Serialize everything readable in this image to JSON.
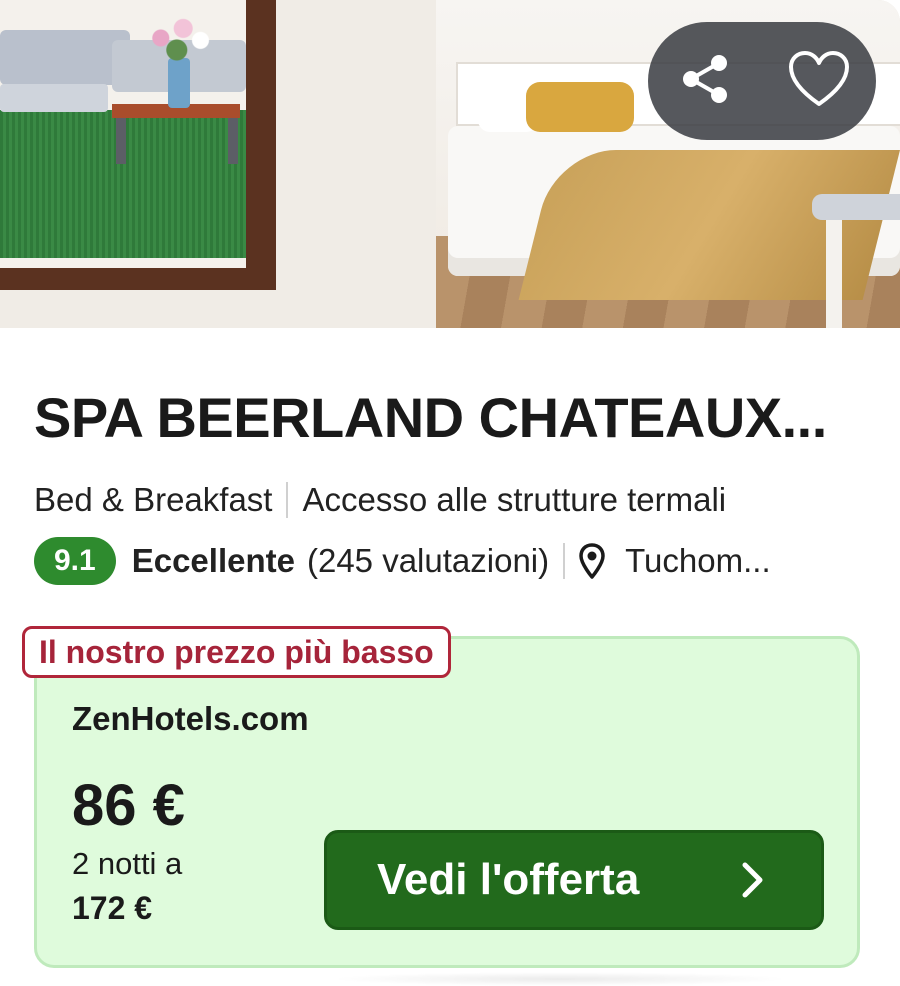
{
  "hotel": {
    "name": "SPA BEERLAND CHATEAUX...",
    "type": "Bed & Breakfast",
    "feature": "Accesso alle strutture termali",
    "rating": {
      "score": "9.1",
      "label": "Eccellente",
      "reviews": "(245 valutazioni)"
    },
    "location": "Tuchom..."
  },
  "actions": {
    "share_icon": "share-icon",
    "favorite_icon": "heart-icon"
  },
  "offer": {
    "badge": "Il nostro prezzo più basso",
    "provider": "ZenHotels.com",
    "price": "86 €",
    "nights_text": "2 notti a",
    "total": "172 €",
    "cta_label": "Vedi l'offerta"
  },
  "colors": {
    "score_badge": "#2e8b2e",
    "offer_bg": "#dffbdc",
    "badge_red": "#b0263a",
    "cta_green": "#226a1c"
  }
}
